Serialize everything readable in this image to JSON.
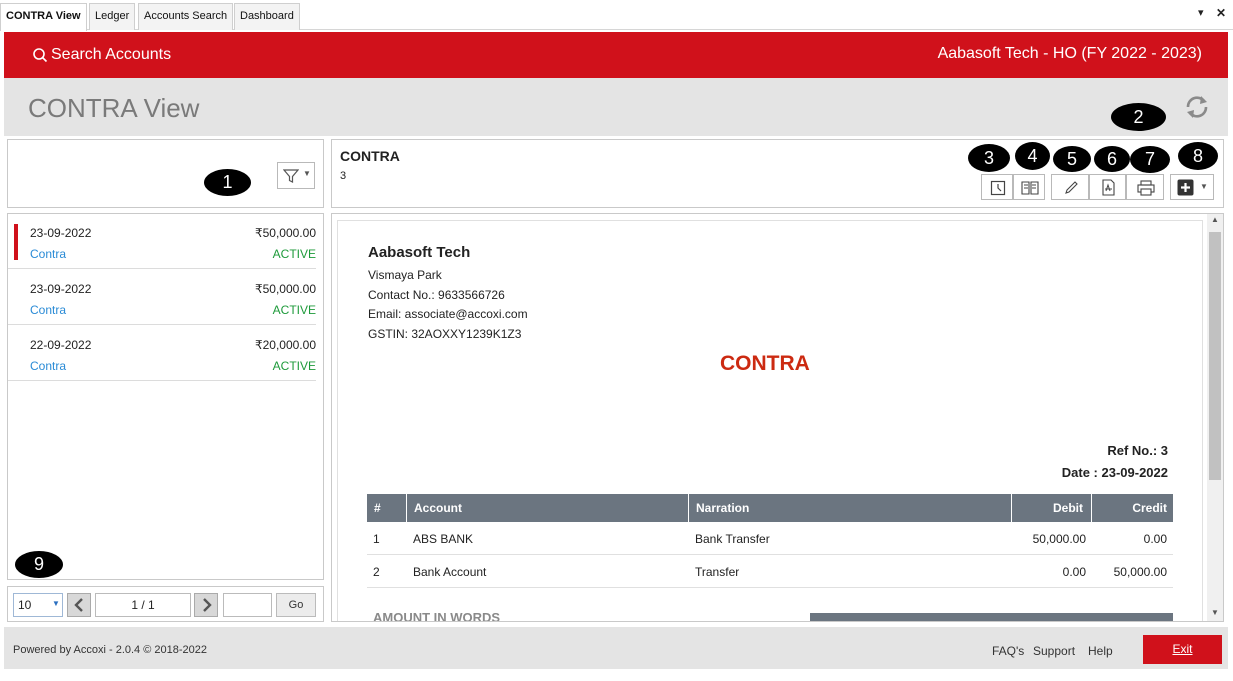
{
  "tabs": [
    {
      "label": "CONTRA View"
    },
    {
      "label": "Ledger"
    },
    {
      "label": "Accounts Search"
    },
    {
      "label": "Dashboard"
    }
  ],
  "window_controls": {
    "dropdown": "▾",
    "close": "✕"
  },
  "header": {
    "search_label": "Search Accounts",
    "company": "Aabasoft Tech - HO (FY 2022 - 2023)"
  },
  "page": {
    "title": "CONTRA View"
  },
  "annotations": [
    "1",
    "2",
    "3",
    "4",
    "5",
    "6",
    "7",
    "8",
    "9"
  ],
  "list": {
    "items": [
      {
        "date": "23-09-2022",
        "amount": "₹50,000.00",
        "type": "Contra",
        "status": "ACTIVE"
      },
      {
        "date": "23-09-2022",
        "amount": "₹50,000.00",
        "type": "Contra",
        "status": "ACTIVE"
      },
      {
        "date": "22-09-2022",
        "amount": "₹20,000.00",
        "type": "Contra",
        "status": "ACTIVE"
      }
    ]
  },
  "pagination": {
    "page_size": "10",
    "page_info": "1 / 1",
    "goto_value": "",
    "go_label": "Go"
  },
  "detail": {
    "type": "CONTRA",
    "number": "3"
  },
  "voucher": {
    "company": "Aabasoft Tech",
    "address": "Vismaya Park",
    "contact": "Contact No.: 9633566726",
    "email": "Email: associate@accoxi.com",
    "gstin": "GSTIN: 32AOXXY1239K1Z3",
    "title": "CONTRA",
    "ref": "Ref No.: 3",
    "date": "Date : 23-09-2022",
    "columns": {
      "num": "#",
      "account": "Account",
      "narration": "Narration",
      "debit": "Debit",
      "credit": "Credit"
    },
    "rows": [
      {
        "num": "1",
        "account": "ABS BANK",
        "narration": "Bank Transfer",
        "debit": "50,000.00",
        "credit": "0.00"
      },
      {
        "num": "2",
        "account": "Bank Account",
        "narration": "Transfer",
        "debit": "0.00",
        "credit": "50,000.00"
      }
    ],
    "amount_words_label": "AMOUNT IN WORDS"
  },
  "footer": {
    "powered": "Powered by Accoxi - 2.0.4 © 2018-2022",
    "faq": "FAQ's",
    "support": "Support",
    "help": "Help",
    "exit": "Exit"
  },
  "colors": {
    "brand_red": "#d0111b",
    "active_green": "#1d9a3a",
    "link_blue": "#2a8bd6",
    "table_header": "#6b7580"
  }
}
